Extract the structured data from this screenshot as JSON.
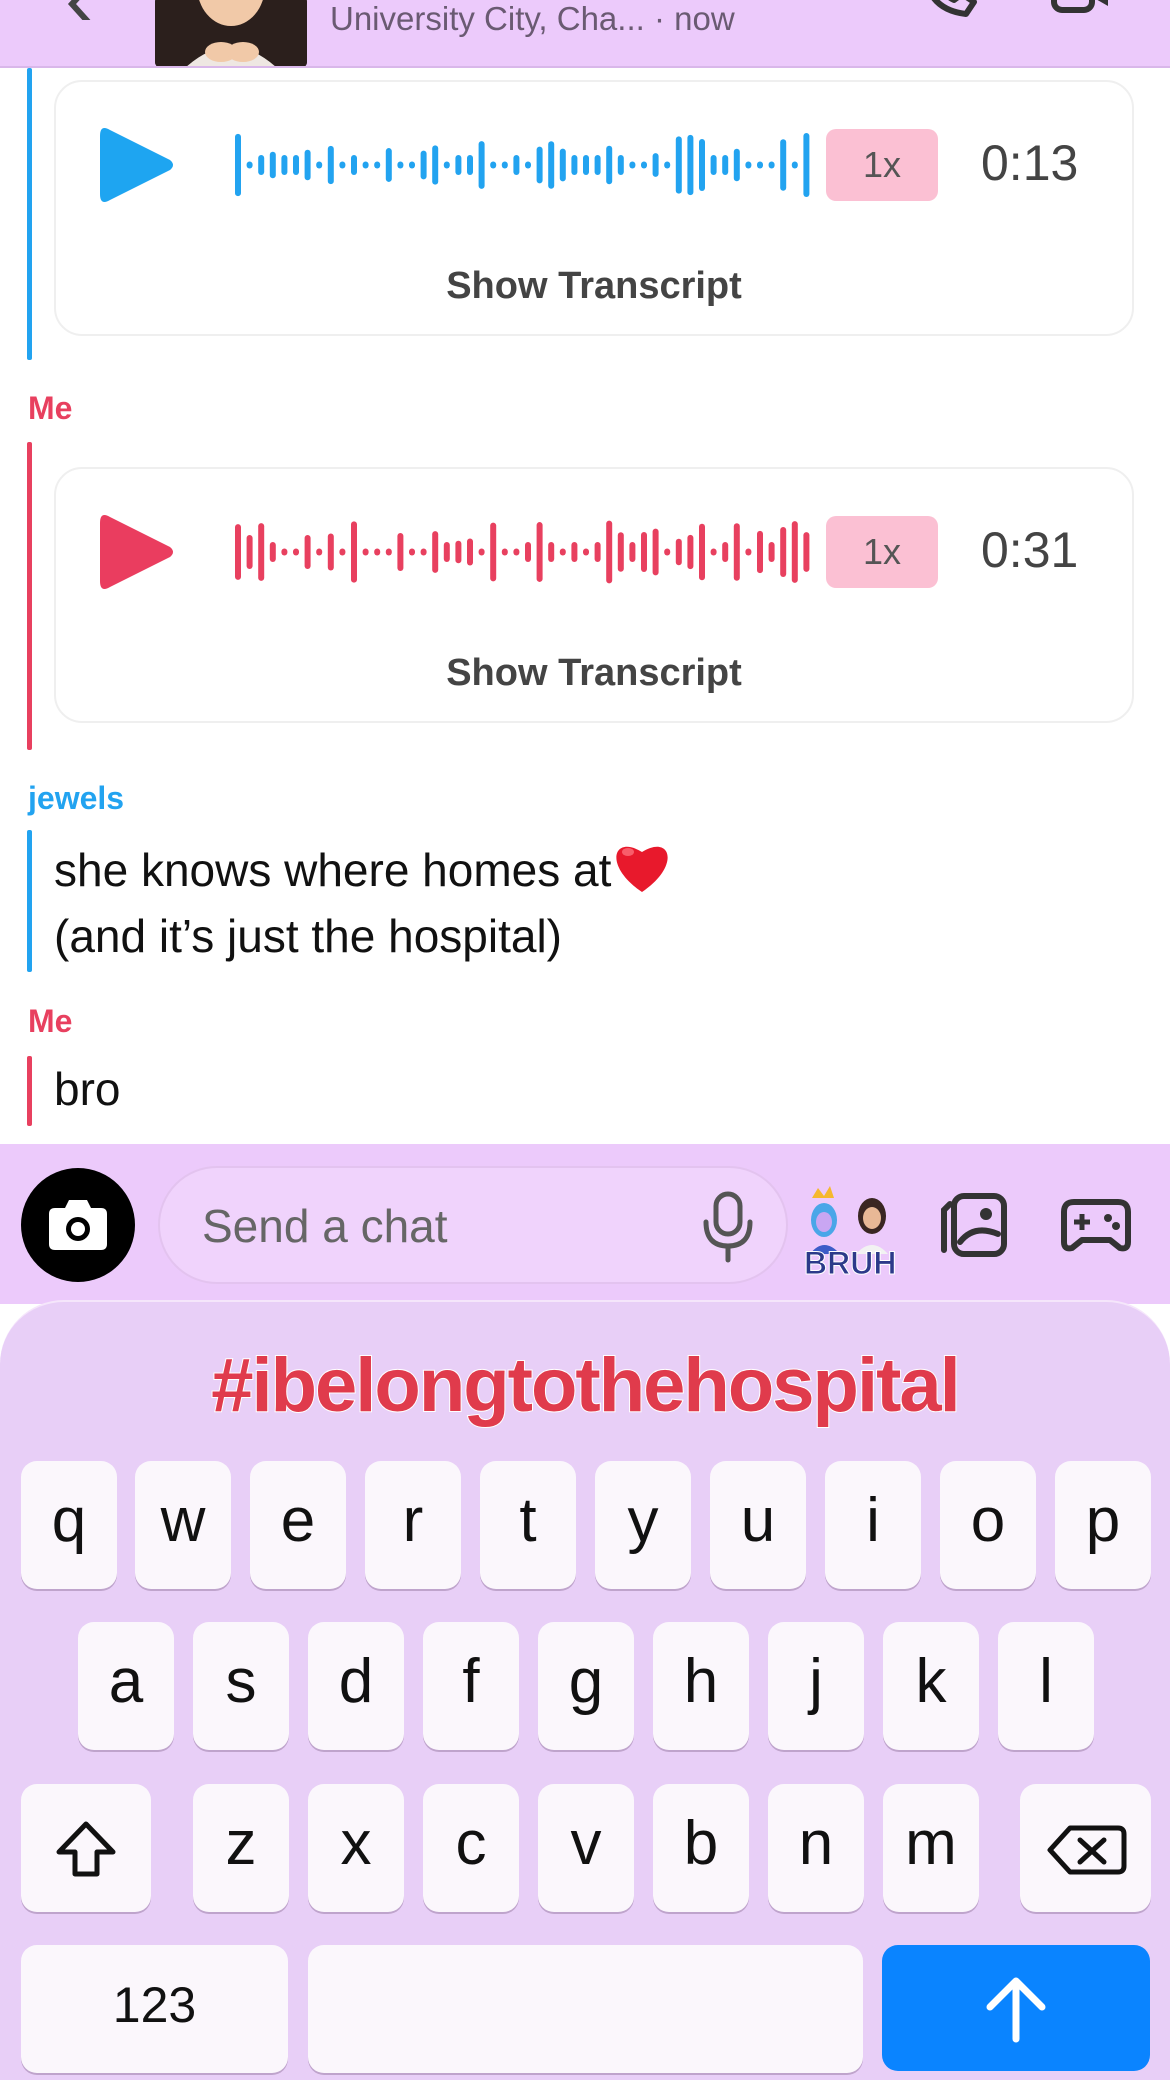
{
  "header": {
    "subtitle": "University City, Cha... · now"
  },
  "messages": [
    {
      "type": "voice",
      "sender": "",
      "speed": "1x",
      "duration": "0:13",
      "transcript_label": "Show Transcript",
      "color": "#22a3f0"
    },
    {
      "type": "voice",
      "sender": "Me",
      "speed": "1x",
      "duration": "0:31",
      "transcript_label": "Show Transcript",
      "color": "#e8405f"
    },
    {
      "type": "text",
      "sender": "jewels",
      "lines": [
        "she knows where homes at",
        "(and it’s just the hospital)"
      ],
      "color": "#22a3f0"
    },
    {
      "type": "text",
      "sender": "Me",
      "lines": [
        "bro"
      ],
      "color": "#e8405f"
    }
  ],
  "input": {
    "placeholder": "Send a chat",
    "sticker_text": "BRUH"
  },
  "keyboard": {
    "suggestion": "#ibelongtothehospital",
    "row1": [
      "q",
      "w",
      "e",
      "r",
      "t",
      "y",
      "u",
      "i",
      "o",
      "p"
    ],
    "row2": [
      "a",
      "s",
      "d",
      "f",
      "g",
      "h",
      "j",
      "k",
      "l"
    ],
    "row3": [
      "z",
      "x",
      "c",
      "v",
      "b",
      "n",
      "m"
    ],
    "numbers_label": "123"
  },
  "icons": [
    "back-icon",
    "phone-icon",
    "video-icon",
    "play-icon",
    "heart-emoji",
    "camera-icon",
    "microphone-icon",
    "bitmoji-sticker",
    "memories-icon",
    "games-icon",
    "shift-icon",
    "backspace-icon",
    "send-arrow-icon"
  ]
}
